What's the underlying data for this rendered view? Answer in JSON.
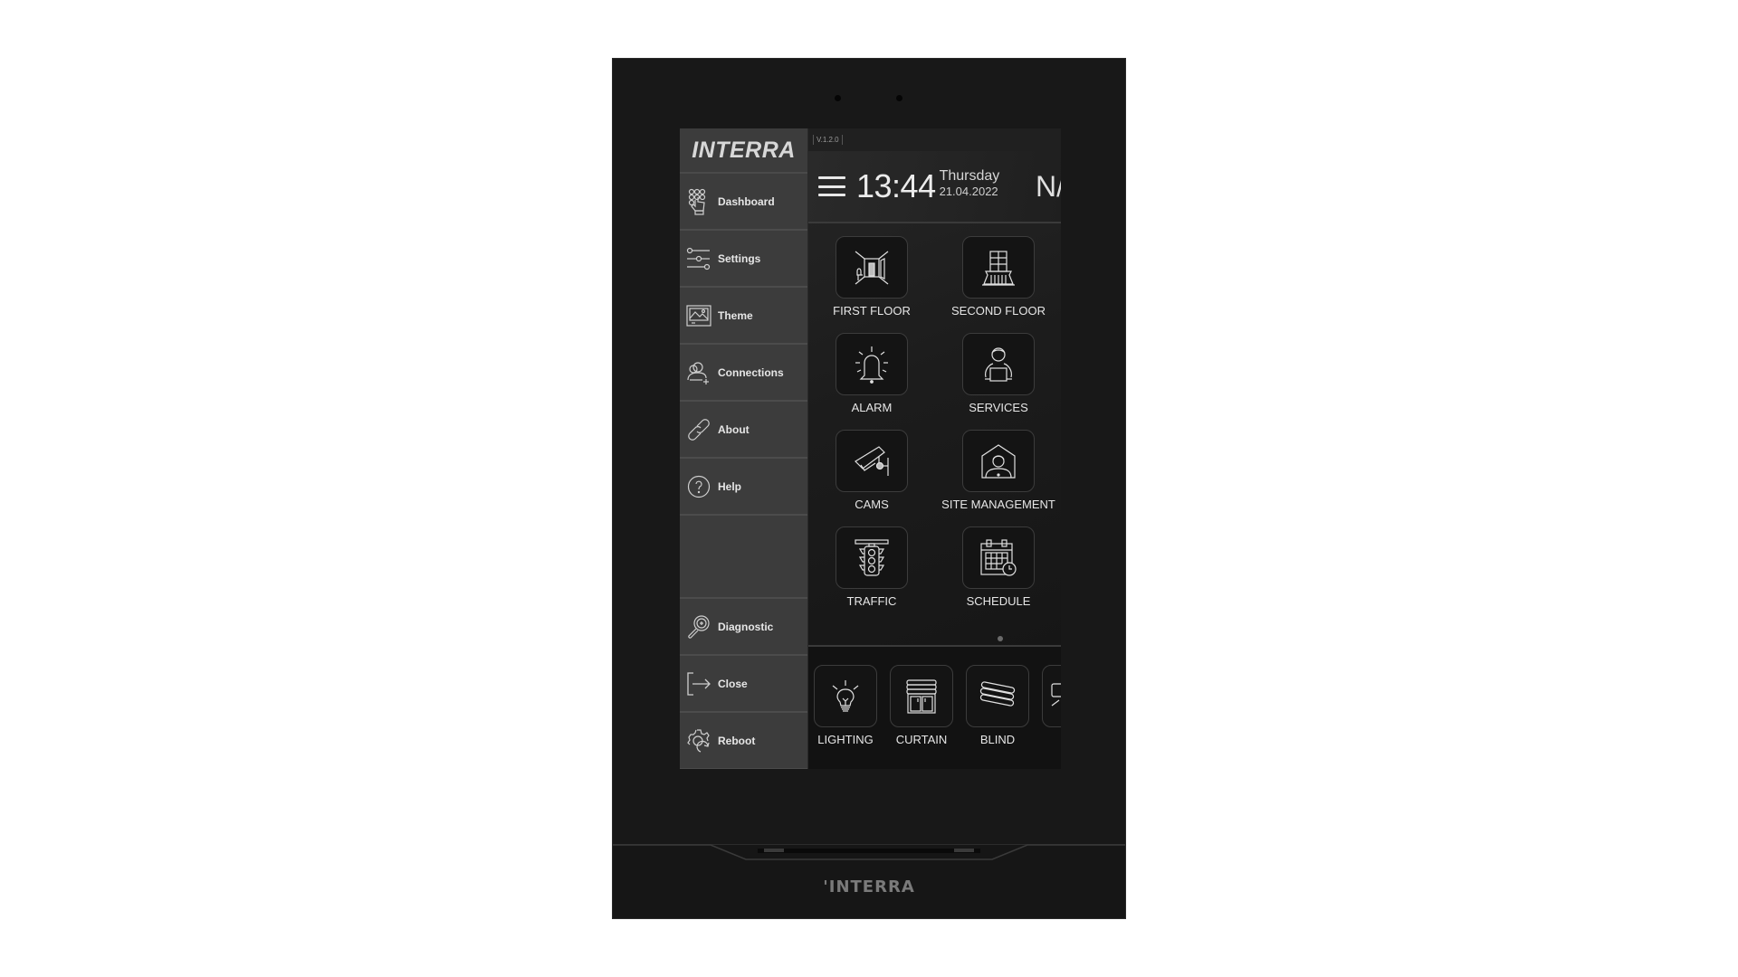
{
  "device": {
    "brand_bottom": "'INTERRA"
  },
  "sidebar": {
    "logo": "INTERRA",
    "items": [
      {
        "label": "Dashboard",
        "icon": "hand-keypad-icon"
      },
      {
        "label": "Settings",
        "icon": "sliders-icon"
      },
      {
        "label": "Theme",
        "icon": "image-frame-icon"
      },
      {
        "label": "Connections",
        "icon": "user-add-icon"
      },
      {
        "label": "About",
        "icon": "link-icon"
      },
      {
        "label": "Help",
        "icon": "help-circle-icon"
      }
    ],
    "bottom_items": [
      {
        "label": "Diagnostic",
        "icon": "magnifier-plus-icon"
      },
      {
        "label": "Close",
        "icon": "exit-icon"
      },
      {
        "label": "Reboot",
        "icon": "gear-refresh-icon"
      }
    ]
  },
  "header": {
    "version": "V.1.2.0",
    "time": "13:44",
    "day": "Thursday",
    "date": "21.04.2022",
    "right_text": "N/"
  },
  "tiles": [
    {
      "label": "FIRST FLOOR",
      "icon": "room-icon"
    },
    {
      "label": "SECOND FLOOR",
      "icon": "balcony-window-icon"
    },
    {
      "label": "ALARM",
      "icon": "alarm-bell-icon"
    },
    {
      "label": "SERVICES",
      "icon": "person-laptop-icon"
    },
    {
      "label": "CAMS",
      "icon": "security-camera-icon"
    },
    {
      "label": "SITE MANAGEMENT",
      "icon": "house-person-icon"
    },
    {
      "label": "TRAFFIC",
      "icon": "traffic-light-icon"
    },
    {
      "label": "SCHEDULE",
      "icon": "calendar-clock-icon"
    }
  ],
  "pagination": {
    "current_page": 1,
    "total_pages": 1
  },
  "dock": [
    {
      "label": "LIGHTING",
      "icon": "light-bulb-icon"
    },
    {
      "label": "CURTAIN",
      "icon": "curtain-icon"
    },
    {
      "label": "BLIND",
      "icon": "blind-icon"
    },
    {
      "label": "",
      "icon": "partial-tile-icon"
    }
  ]
}
